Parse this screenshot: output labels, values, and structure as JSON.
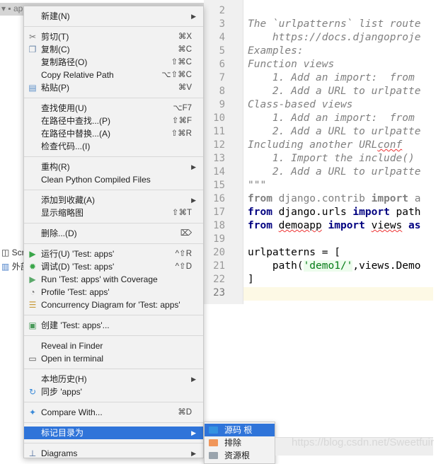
{
  "tree": {
    "root": "apps",
    "items": [
      {
        "label": "Scratches",
        "visible": "Scr"
      },
      {
        "label": "外部库",
        "visible": "外部"
      }
    ]
  },
  "editor": {
    "line_numbers": [
      "2",
      "3",
      "4",
      "5",
      "6",
      "7",
      "8",
      "9",
      "10",
      "11",
      "12",
      "13",
      "14",
      "15",
      "16",
      "17",
      "18",
      "19",
      "20",
      "21",
      "22",
      "23"
    ],
    "lines": {
      "l3": "The `urlpatterns` list route",
      "l4": "    https://docs.djangoproje",
      "l5": "Examples:",
      "l6": "Function views",
      "l7": "    1. Add an import:  from",
      "l8": "    2. Add a URL to urlpatte",
      "l9": "Class-based views",
      "l10": "    1. Add an import:  from",
      "l11": "    2. Add a URL to urlpatte",
      "l12a": "Including another URL",
      "l12b": "conf",
      "l13": "    1. Import the include()",
      "l14": "    2. Add a URL to urlpatte",
      "l15": "\"\"\"",
      "l16": {
        "k1": "from",
        "m1": " django.contrib ",
        "k2": "import",
        "m2": " a"
      },
      "l17": {
        "k1": "from",
        "m1": " django.urls ",
        "k2": "import",
        "m2": " path"
      },
      "l18": {
        "k1": "from",
        "m1": " ",
        "w1": "demoapp",
        "m2": " ",
        "k2": "import",
        "m3": " ",
        "w2": "views",
        "m4": " ",
        "k3": "as"
      },
      "l20": "urlpatterns = [",
      "l21": {
        "a": "    path(",
        "s": "'demo1/'",
        "b": ",views.Demo"
      },
      "l22": "]"
    }
  },
  "menu": {
    "items": [
      {
        "label": "新建(N)",
        "submenu": true
      },
      {
        "label": "剪切(T)",
        "shortcut": "⌘X",
        "icon": "scissors-icon"
      },
      {
        "label": "复制(C)",
        "shortcut": "⌘C",
        "icon": "copy-icon"
      },
      {
        "label": "复制路径(O)",
        "shortcut": "⇧⌘C"
      },
      {
        "label": "Copy Relative Path",
        "shortcut": "⌥⇧⌘C"
      },
      {
        "label": "粘贴(P)",
        "shortcut": "⌘V",
        "icon": "paste-icon"
      },
      {
        "label": "查找使用(U)",
        "shortcut": "⌥F7"
      },
      {
        "label": "在路径中查找...(P)",
        "shortcut": "⇧⌘F"
      },
      {
        "label": "在路径中替换...(A)",
        "shortcut": "⇧⌘R"
      },
      {
        "label": "检查代码...(I)"
      },
      {
        "label": "重构(R)",
        "submenu": true
      },
      {
        "label": "Clean Python Compiled Files"
      },
      {
        "label": "添加到收藏(A)",
        "submenu": true
      },
      {
        "label": "显示缩略图",
        "shortcut": "⇧⌘T"
      },
      {
        "label": "删除...(D)",
        "shortcut": "⌦"
      },
      {
        "label": "运行(U) 'Test: apps'",
        "shortcut": "^⇧R",
        "icon": "run-icon"
      },
      {
        "label": "调试(D) 'Test: apps'",
        "shortcut": "^⇧D",
        "icon": "debug-icon"
      },
      {
        "label": "Run 'Test: apps' with Coverage",
        "icon": "coverage-icon"
      },
      {
        "label": "Profile 'Test: apps'",
        "icon": "profile-icon"
      },
      {
        "label": "Concurrency Diagram for 'Test: apps'",
        "icon": "concurrency-icon"
      },
      {
        "label": "创建 'Test: apps'...",
        "icon": "create-config-icon"
      },
      {
        "label": "Reveal in Finder"
      },
      {
        "label": "Open in terminal",
        "icon": "terminal-icon"
      },
      {
        "label": "本地历史(H)",
        "submenu": true
      },
      {
        "label": "同步 'apps'",
        "icon": "sync-icon"
      },
      {
        "label": "Compare With...",
        "shortcut": "⌘D",
        "icon": "compare-icon"
      },
      {
        "label": "标记目录为",
        "submenu": true,
        "highlighted": true
      },
      {
        "label": "Diagrams",
        "submenu": true,
        "icon": "diagram-icon"
      }
    ]
  },
  "submenu": {
    "items": [
      {
        "label": "源码 根",
        "highlighted": true,
        "color": "#3592e0"
      },
      {
        "label": "排除",
        "color": "#f0965a"
      },
      {
        "label": "资源根",
        "color": "#9aa4ad"
      }
    ]
  },
  "colors": {
    "highlight": "#2f74d9",
    "keyword": "#000080",
    "docstring": "#808080",
    "string": "#067d17"
  },
  "watermark": "https://blog.csdn.net/Sweetfuir"
}
